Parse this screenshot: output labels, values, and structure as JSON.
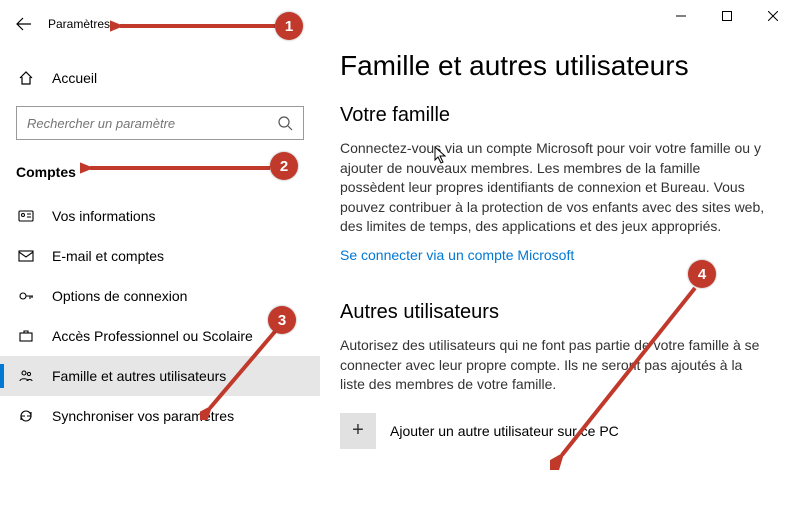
{
  "titlebar": {
    "app_title": "Paramètres"
  },
  "sidebar": {
    "home_label": "Accueil",
    "search_placeholder": "Rechercher un paramètre",
    "section_label": "Comptes",
    "items": [
      {
        "label": "Vos informations"
      },
      {
        "label": "E-mail et comptes"
      },
      {
        "label": "Options de connexion"
      },
      {
        "label": "Accès Professionnel ou Scolaire"
      },
      {
        "label": "Famille et autres utilisateurs"
      },
      {
        "label": "Synchroniser vos paramètres"
      }
    ]
  },
  "content": {
    "page_title": "Famille et autres utilisateurs",
    "family": {
      "heading": "Votre famille",
      "body": "Connectez-vous via un compte Microsoft pour voir votre famille ou y ajouter de nouveaux membres. Les membres de la famille possèdent leur propres identifiants de connexion et Bureau. Vous pouvez contribuer à la protection de vos enfants avec des sites web, des limites de temps, des applications et des jeux appropriés.",
      "link": "Se connecter via un compte Microsoft"
    },
    "others": {
      "heading": "Autres utilisateurs",
      "body": "Autorisez des utilisateurs qui ne font pas partie de votre famille à se connecter avec leur propre compte. Ils ne seront pas ajoutés à la liste des membres de votre famille.",
      "add_label": "Ajouter un autre utilisateur sur ce PC"
    }
  },
  "callouts": {
    "1": "1",
    "2": "2",
    "3": "3",
    "4": "4"
  },
  "colors": {
    "accent": "#0078d4",
    "callout": "#c0392b"
  }
}
